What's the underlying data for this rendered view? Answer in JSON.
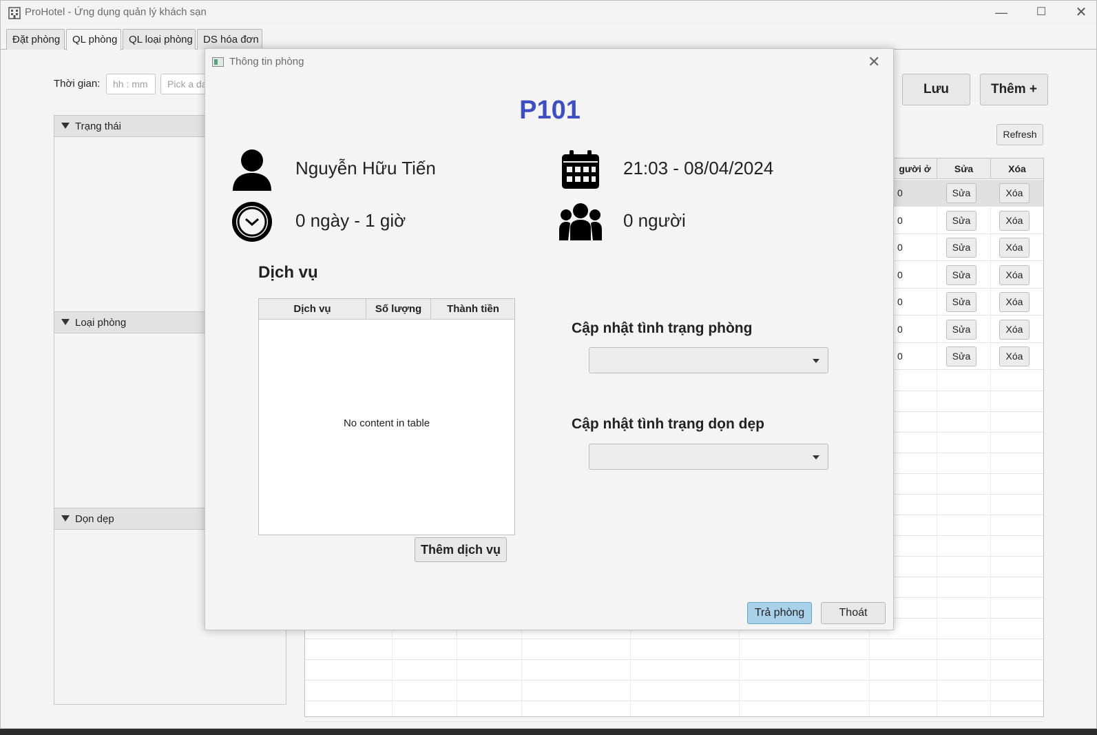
{
  "window": {
    "title": "ProHotel - Ứng dụng quản lý khách sạn"
  },
  "tabs": [
    {
      "label": "Đặt phòng"
    },
    {
      "label": "QL phòng"
    },
    {
      "label": "QL loại phòng"
    },
    {
      "label": "DS hóa đơn"
    }
  ],
  "filter": {
    "time_label": "Thời gian:",
    "time_placeholder": "hh : mm",
    "date_placeholder": "Pick a da"
  },
  "panes": [
    {
      "label": "Trạng thái"
    },
    {
      "label": "Loại phòng"
    },
    {
      "label": "Dọn dẹp"
    }
  ],
  "toolbar": {
    "save_label": "Lưu",
    "add_label": "Thêm +",
    "refresh_label": "Refresh"
  },
  "room_table": {
    "columns": [
      "gười ở",
      "Sửa",
      "Xóa"
    ],
    "rows": [
      {
        "occupants": "0",
        "edit": "Sửa",
        "delete": "Xóa"
      },
      {
        "occupants": "0",
        "edit": "Sửa",
        "delete": "Xóa"
      },
      {
        "occupants": "0",
        "edit": "Sửa",
        "delete": "Xóa"
      },
      {
        "occupants": "0",
        "edit": "Sửa",
        "delete": "Xóa"
      },
      {
        "occupants": "0",
        "edit": "Sửa",
        "delete": "Xóa"
      },
      {
        "occupants": "0",
        "edit": "Sửa",
        "delete": "Xóa"
      },
      {
        "occupants": "0",
        "edit": "Sửa",
        "delete": "Xóa"
      }
    ]
  },
  "dialog": {
    "title": "Thông tin phòng",
    "room_name": "P101",
    "guest_name": "Nguyễn Hữu Tiến",
    "checkin_time": "21:03 - 08/04/2024",
    "duration": "0 ngày - 1 giờ",
    "occupants": "0 người",
    "services_title": "Dịch vụ",
    "services_columns": [
      "Dịch vụ",
      "Số lượng",
      "Thành tiền"
    ],
    "services_empty": "No content in table",
    "add_service_label": "Thêm dịch vụ",
    "room_status_title": "Cập nhật tình trạng phòng",
    "cleaning_status_title": "Cập nhật tình trạng dọn dẹp",
    "checkout_label": "Trả phòng",
    "exit_label": "Thoát"
  },
  "colors": {
    "room_name": "#3f4fbf",
    "primary_button": "#a9d1ea"
  }
}
